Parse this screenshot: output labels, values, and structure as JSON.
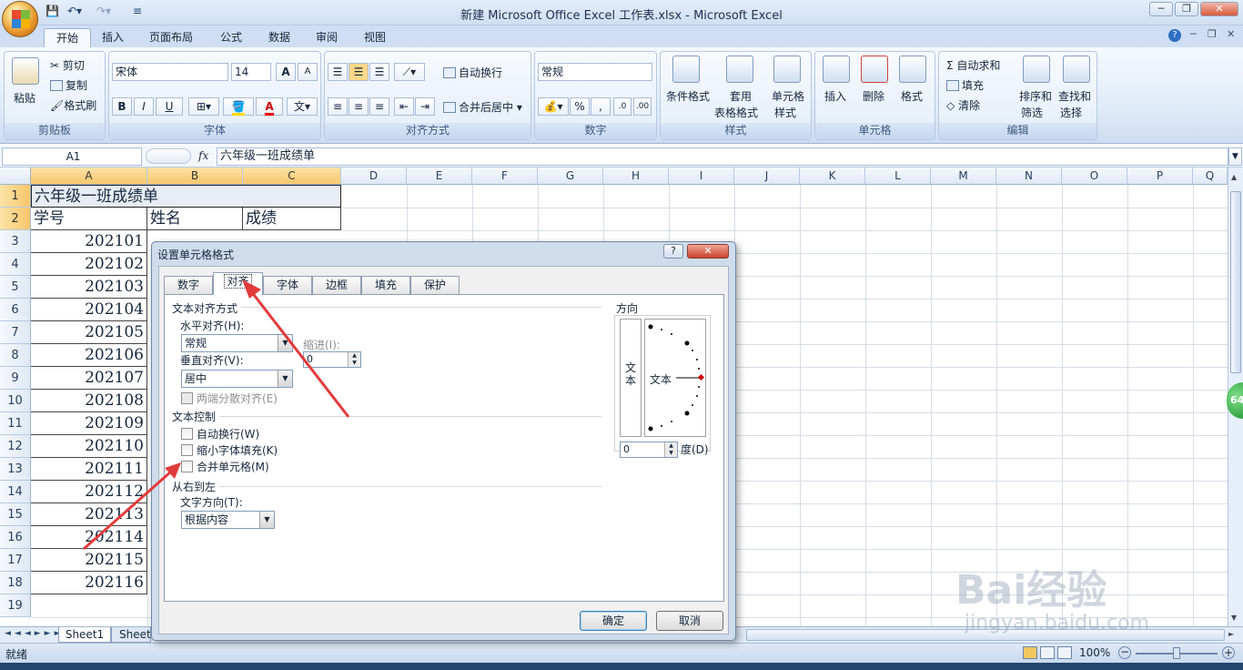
{
  "window": {
    "title": "新建 Microsoft Office Excel 工作表.xlsx - Microsoft Excel",
    "controls": [
      "─",
      "❐",
      "✕"
    ],
    "help": "?"
  },
  "ribbon_tabs": [
    "开始",
    "插入",
    "页面布局",
    "公式",
    "数据",
    "审阅",
    "视图"
  ],
  "ribbon": {
    "clipboard": {
      "label": "剪贴板",
      "paste": "粘贴",
      "cut": "剪切",
      "copy": "复制",
      "format_painter": "格式刷"
    },
    "font": {
      "label": "字体",
      "font_name": "宋体",
      "font_size": "14",
      "bold": "B",
      "italic": "I",
      "underline": "U",
      "grow": "A",
      "shrink": "A"
    },
    "alignment": {
      "label": "对齐方式",
      "wrap": "自动换行",
      "merge": "合并后居中"
    },
    "number": {
      "label": "数字",
      "format": "常规",
      "percent": "%",
      "comma": ","
    },
    "styles": {
      "label": "样式",
      "conditional": "条件格式",
      "table1": "套用",
      "table2": "表格格式",
      "cell1": "单元格",
      "cell2": "样式"
    },
    "cells": {
      "label": "单元格",
      "insert": "插入",
      "delete": "删除",
      "format": "格式"
    },
    "editing": {
      "label": "编辑",
      "autosum": "自动求和",
      "fill": "填充",
      "clear": "清除",
      "sort1": "排序和",
      "sort2": "筛选",
      "find1": "查找和",
      "find2": "选择"
    }
  },
  "formula_bar": {
    "name_box": "A1",
    "fx": "fx",
    "content": "六年级一班成绩单"
  },
  "columns": [
    "A",
    "B",
    "C",
    "D",
    "E",
    "F",
    "G",
    "H",
    "I",
    "J",
    "K",
    "L",
    "M",
    "N",
    "O",
    "P",
    "Q"
  ],
  "rows": [
    "1",
    "2",
    "3",
    "4",
    "5",
    "6",
    "7",
    "8",
    "9",
    "10",
    "11",
    "12",
    "13",
    "14",
    "15",
    "16",
    "17",
    "18",
    "19"
  ],
  "cells": {
    "a1": "六年级一班成绩单",
    "a2": "学号",
    "b2": "姓名",
    "c2": "成绩",
    "ids": [
      "202101",
      "202102",
      "202103",
      "202104",
      "202105",
      "202106",
      "202107",
      "202108",
      "202109",
      "202110",
      "202111",
      "202112",
      "202113",
      "202114",
      "202115",
      "202116"
    ]
  },
  "sheet_tabs": [
    "Sheet1",
    "Sheet"
  ],
  "status": {
    "ready": "就绪",
    "zoom": "100%",
    "side_badge": "64"
  },
  "dialog": {
    "title": "设置单元格格式",
    "help": "?",
    "tabs": [
      "数字",
      "对齐",
      "字体",
      "边框",
      "填充",
      "保护"
    ],
    "text_align_section": "文本对齐方式",
    "horizontal_label": "水平对齐(H):",
    "horizontal_value": "常规",
    "indent_label": "缩进(I):",
    "indent_value": "0",
    "vertical_label": "垂直对齐(V):",
    "vertical_value": "居中",
    "justify_distributed": "两端分散对齐(E)",
    "text_control_section": "文本控制",
    "wrap_text": "自动换行(W)",
    "shrink_to_fit": "缩小字体填充(K)",
    "merge_cells": "合并单元格(M)",
    "rtl_section": "从右到左",
    "text_direction_label": "文字方向(T):",
    "text_direction_value": "根据内容",
    "orientation_section": "方向",
    "vertical_text": "文本",
    "orientation_text": "文本",
    "degrees_value": "0",
    "degrees_label": "度(D)",
    "ok": "确定",
    "cancel": "取消"
  },
  "watermark": {
    "brand": "Bai经验",
    "url": "jingyan.baidu.com"
  },
  "colors": {
    "arrow": "#e23a3a",
    "ribbon": "#dde9f7",
    "selected_header": "#f8c66c"
  }
}
